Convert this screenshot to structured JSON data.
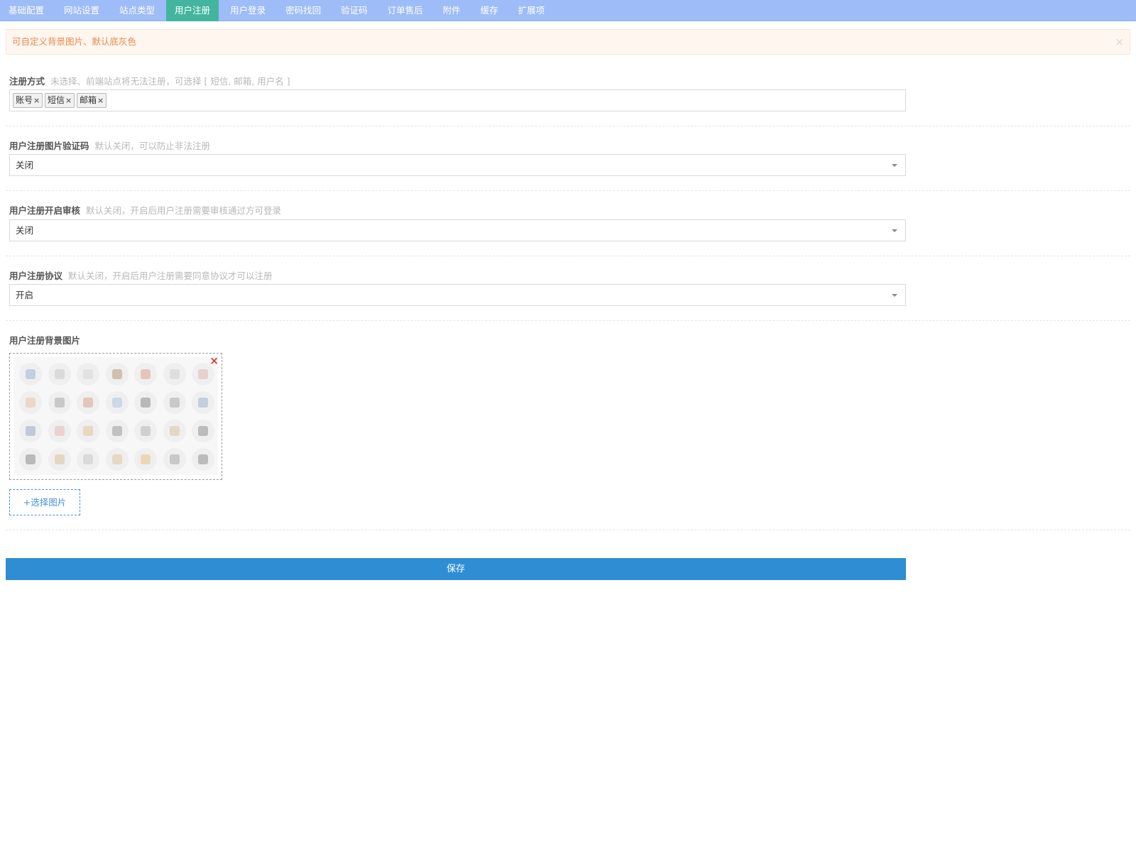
{
  "tabs": [
    {
      "label": "基础配置",
      "active": false
    },
    {
      "label": "网站设置",
      "active": false
    },
    {
      "label": "站点类型",
      "active": false
    },
    {
      "label": "用户注册",
      "active": true
    },
    {
      "label": "用户登录",
      "active": false
    },
    {
      "label": "密码找回",
      "active": false
    },
    {
      "label": "验证码",
      "active": false
    },
    {
      "label": "订单售后",
      "active": false
    },
    {
      "label": "附件",
      "active": false
    },
    {
      "label": "缓存",
      "active": false
    },
    {
      "label": "扩展项",
      "active": false
    }
  ],
  "notice": {
    "text": "可自定义背景图片、默认底灰色",
    "close_icon": "close-icon",
    "close_glyph": "×"
  },
  "fields": {
    "reg_method": {
      "label": "注册方式",
      "tip": "未选择、前端站点将无法注册，可选择 [ 短信, 邮箱, 用户名 ]",
      "tags": [
        {
          "label": "账号",
          "remove_glyph": "×"
        },
        {
          "label": "短信",
          "remove_glyph": "×"
        },
        {
          "label": "邮箱",
          "remove_glyph": "×"
        }
      ]
    },
    "captcha": {
      "label": "用户注册图片验证码",
      "tip": "默认关闭，可以防止非法注册",
      "value": "关闭"
    },
    "review": {
      "label": "用户注册开启审核",
      "tip": "默认关闭，开启后用户注册需要审核通过方可登录",
      "value": "关闭"
    },
    "agreement": {
      "label": "用户注册协议",
      "tip": "默认关闭，开启后用户注册需要同意协议才可以注册",
      "value": "开启"
    },
    "background": {
      "label": "用户注册背景图片",
      "delete_glyph": "×",
      "choose_label": "+选择图片"
    }
  },
  "save_label": "保存",
  "colors": {
    "tabbar": "#9ebcf7",
    "tab_active": "#43b59f",
    "notice_text": "#e58c4c",
    "save": "#2f8ed3",
    "link": "#4a90d9"
  }
}
